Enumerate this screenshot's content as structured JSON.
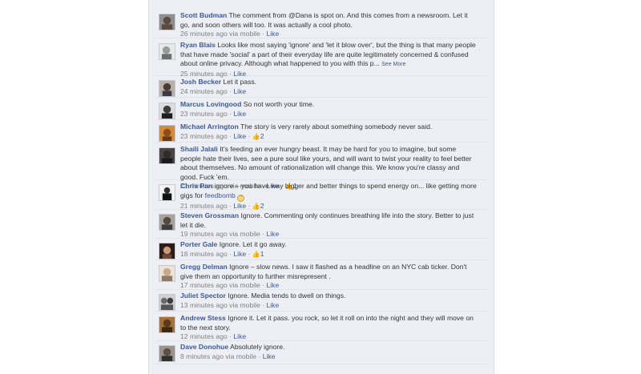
{
  "comments": [
    {
      "author": "Scott Budman",
      "text": "The comment from @Dana is spot on. And this comes from a newsroom. Let it go, and soon others will too. It was actually a cool photo.",
      "time": "26 minutes ago via mobile",
      "like": "Like",
      "likes": "",
      "avatar_color": "#5b4a3e"
    },
    {
      "author": "Ryan Blais",
      "text": "Looks like most saying 'ignore' and 'let it blow over', but the thing is that many people that have made 'social' a part of their everyday life are quite legitimately concerned & confused about online privacy. Although what happened to you with this p...",
      "see_more": "See More",
      "time": "25 minutes ago",
      "like": "Like",
      "likes": "",
      "avatar_color": "#c9c9c9"
    },
    {
      "author": "Josh Becker",
      "text": "Let it pass.",
      "time": "24 minutes ago",
      "like": "Like",
      "likes": "",
      "avatar_color": "#4a3b33"
    },
    {
      "author": "Marcus Lovingood",
      "text": "So not worth your time.",
      "time": "23 minutes ago",
      "like": "Like",
      "likes": "",
      "avatar_color": "#3d3d3d"
    },
    {
      "author": "Michael Arrington",
      "text": "The story is very rarely about something somebody never said.",
      "time": "23 minutes ago",
      "like": "Like",
      "likes": "2",
      "avatar_color": "#b8742e"
    },
    {
      "author": "Shaili Jalali",
      "text": "It's feeding an ever hungry beast. It may be hard for you to imagine, but some people hate their lives, see a pure soul like yours, and will want to twist your reality to feel better about themselves. No amount of rationalization will change this. We know you're classy and good. Fuck 'em.",
      "time": "21 minutes ago via mobile",
      "like": "Like",
      "likes": "1",
      "avatar_color": "#2e2a2a"
    },
    {
      "author": "Chris Pan",
      "text_before": "ignore – you have way bigger and better things to spend energy on... like getting more gigs for",
      "link": "feedbomb",
      "time": "21 minutes ago",
      "like": "Like",
      "likes": "2",
      "avatar_color": "#2c2c2c"
    },
    {
      "author": "Steven Grossman",
      "text": "Ignore. Commenting only continues breathing life into the story. Better to just let it die.",
      "time": "19 minutes ago via mobile",
      "like": "Like",
      "likes": "",
      "avatar_color": "#55493f"
    },
    {
      "author": "Porter Gale",
      "text": "Ignore. Let it go away.",
      "time": "18 minutes ago",
      "like": "Like",
      "likes": "1",
      "avatar_color": "#6b4a3a"
    },
    {
      "author": "Gregg Delman",
      "text": "Ignore – slow news. I saw it flashed as a headline on an NYC cab ticker. Don't give them an opportunity to further misrepresent .",
      "time": "17 minutes ago via mobile",
      "like": "Like",
      "likes": "",
      "avatar_color": "#d8c7b3"
    },
    {
      "author": "Juliet Spector",
      "text": "Ignore. Media tends to dwell on things.",
      "time": "13 minutes ago via mobile",
      "like": "Like",
      "likes": "",
      "avatar_color": "#8a8a8a"
    },
    {
      "author": "Andrew Stess",
      "text": "Ignore it. Let it pass. you rock, so let it roll on into the night and they will move on to the next story.",
      "time": "12 minutes ago",
      "like": "Like",
      "likes": "",
      "avatar_color": "#7a5328"
    },
    {
      "author": "Dave Donohue",
      "text": "Absolutely ignore.",
      "time": "8 minutes ago via mobile",
      "like": "Like",
      "likes": "",
      "avatar_color": "#5c5247"
    }
  ]
}
